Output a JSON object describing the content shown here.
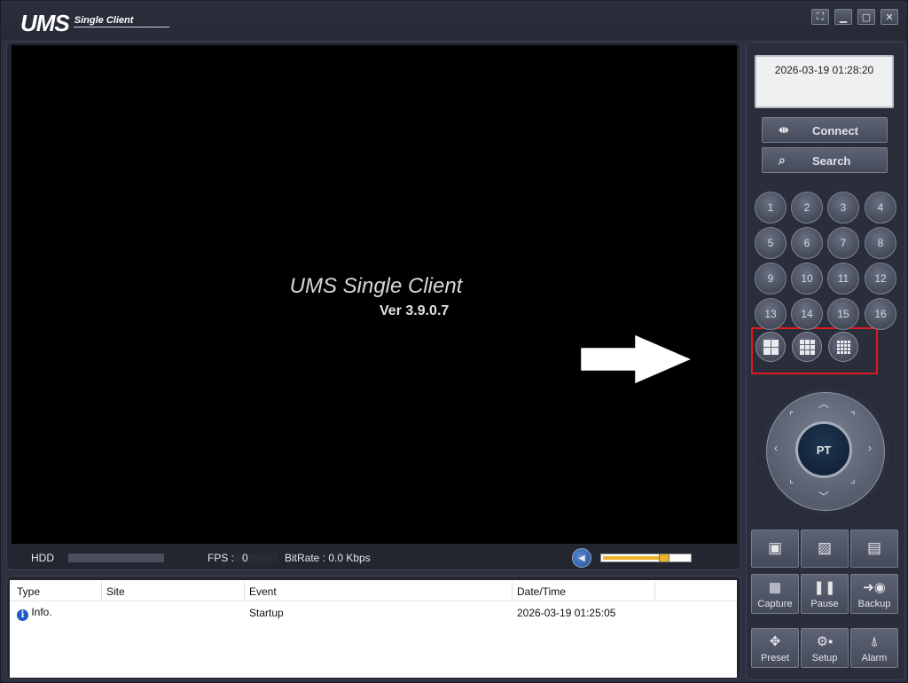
{
  "title": {
    "logo": "UMS",
    "sub": "Single Client"
  },
  "window_controls": {
    "fullscreen": "⛶",
    "minimize": "▁",
    "maximize": "▢",
    "close": "✕"
  },
  "video": {
    "splash_title": "UMS Single Client",
    "splash_version": "Ver 3.9.0.7"
  },
  "status": {
    "hdd_label": "HDD",
    "fps_label": "FPS :",
    "fps_value": "0",
    "bitrate_label": "BitRate :  0.0 Kbps",
    "volume_level": 0.72
  },
  "log": {
    "columns": [
      "Type",
      "Site",
      "Event",
      "Date/Time"
    ],
    "rows": [
      {
        "type": "Info.",
        "site": "",
        "event": "Startup",
        "datetime": "2026-03-19 01:25:05"
      }
    ]
  },
  "clock": "2026-03-19 01:28:20",
  "buttons": {
    "connect": "Connect",
    "search": "Search"
  },
  "channels": [
    "1",
    "2",
    "3",
    "4",
    "5",
    "6",
    "7",
    "8",
    "9",
    "10",
    "11",
    "12",
    "13",
    "14",
    "15",
    "16"
  ],
  "ptz": {
    "center": "PT"
  },
  "tools": {
    "capture": "Capture",
    "pause": "Pause",
    "backup": "Backup",
    "preset": "Preset",
    "setup": "Setup",
    "alarm": "Alarm"
  },
  "colors": {
    "highlight": "#e0191f",
    "volume": "#f0b22a",
    "info": "#1e5bc6"
  }
}
